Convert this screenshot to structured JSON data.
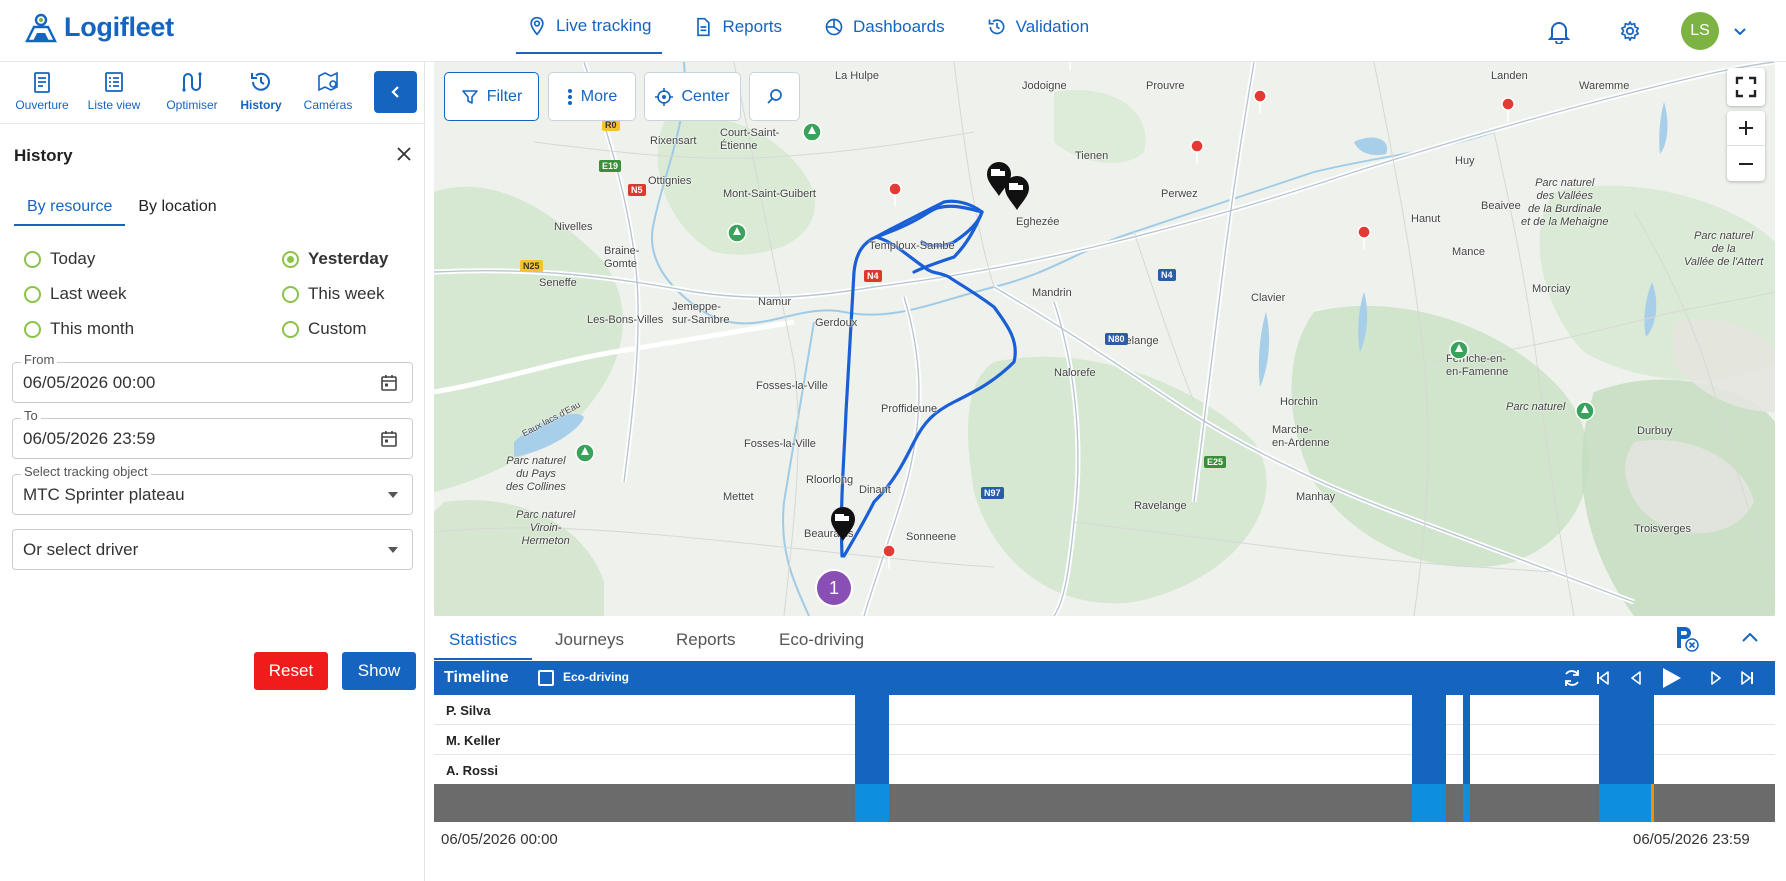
{
  "brand": {
    "name": "Logifleet"
  },
  "nav": {
    "items": [
      {
        "label": "Live tracking",
        "icon": "location-pin-icon",
        "active": true
      },
      {
        "label": "Reports",
        "icon": "document-icon"
      },
      {
        "label": "Dashboards",
        "icon": "dashboard-icon"
      },
      {
        "label": "Validation",
        "icon": "history-icon"
      }
    ],
    "user_initials": "LS",
    "avatar_color": "#7cb342"
  },
  "tools": [
    {
      "label": "Ouverture",
      "icon": "clipboard-icon"
    },
    {
      "label": "Liste view",
      "icon": "list-icon"
    },
    {
      "label": "Optimiser",
      "icon": "route-icon"
    },
    {
      "label": "History",
      "icon": "history-icon",
      "active": true
    },
    {
      "label": "Caméras",
      "icon": "camera-map-icon"
    }
  ],
  "history": {
    "title": "History",
    "tabs": [
      "By resource",
      "By location"
    ],
    "active_tab": "By resource",
    "periods": [
      "Today",
      "Yesterday",
      "Last week",
      "This week",
      "This month",
      "Custom"
    ],
    "selected_period": "Yesterday",
    "from_label": "From",
    "from_value": "06/05/2026 00:00",
    "to_label": "To",
    "to_value": "06/05/2026 23:59",
    "tracking_label": "Select tracking object",
    "tracking_value": "MTC Sprinter plateau",
    "driver_placeholder": "Or select driver",
    "reset_label": "Reset",
    "show_label": "Show"
  },
  "map": {
    "buttons": {
      "filter": "Filter",
      "more": "More",
      "center": "Center"
    },
    "cluster_count": "1",
    "places": [
      "La Hulpe",
      "Jodoigne",
      "Prouvre",
      "Landen",
      "Waremme",
      "Rixensart",
      "Court-Saint-\nÉtienne",
      "Ottignies",
      "Tienen",
      "Mont-Saint-Guibert",
      "Perwez",
      "Huy",
      "Nivelles",
      "Eghezée",
      "Hanut",
      "Beaivee",
      "Braine-\nGomte",
      "Temploux-Sambe",
      "Mance",
      "Seneffe",
      "Namur",
      "Mandrin",
      "Clavier",
      "Jemeppe-\nsur-Sambre",
      "Les-Bons-Villes",
      "Gerdoux",
      "Havelange",
      "Morciay",
      "Ferriche-en-\nen-Famenne",
      "Fosses-la-Ville",
      "Nalorefe",
      "Proffideune",
      "Horchin",
      "Fosses-la-Ville",
      "Marche-\nen-Ardenne",
      "Durbuy",
      "Rloorlong",
      "Dinant",
      "Mettet",
      "Manhay",
      "Beaurains",
      "Ravelange",
      "Sonneene",
      "Troisverges",
      "Eaux lacs d'Eau"
    ],
    "parks": [
      "Parc naturel\ndes Vallées\nde la Burdinale\net de la Mehaigne",
      "Parc naturel\nde la\nVallée de l'Attert",
      "Parc naturel\ndu Pays\ndes Collines",
      "Parc naturel\nViroin-\nHermeton",
      "Parc naturel"
    ],
    "road_labels": [
      "R0",
      "E19",
      "N5",
      "N25",
      "N4",
      "N4",
      "N80",
      "N97",
      "E25"
    ]
  },
  "bottom": {
    "tabs": [
      "Statistics",
      "Journeys",
      "Reports",
      "Eco-driving"
    ],
    "active_tab": "Statistics",
    "timeline_label": "Timeline",
    "eco_label": "Eco-driving",
    "drivers": [
      "P. Silva",
      "M. Keller",
      "A. Rossi"
    ],
    "start_label": "06/05/2026 00:00",
    "end_label": "06/05/2026 23:59"
  },
  "colors": {
    "accent": "#1565c0",
    "reset": "#f01c1c",
    "radio": "#8bc34a",
    "track": "#1a5fd6"
  }
}
